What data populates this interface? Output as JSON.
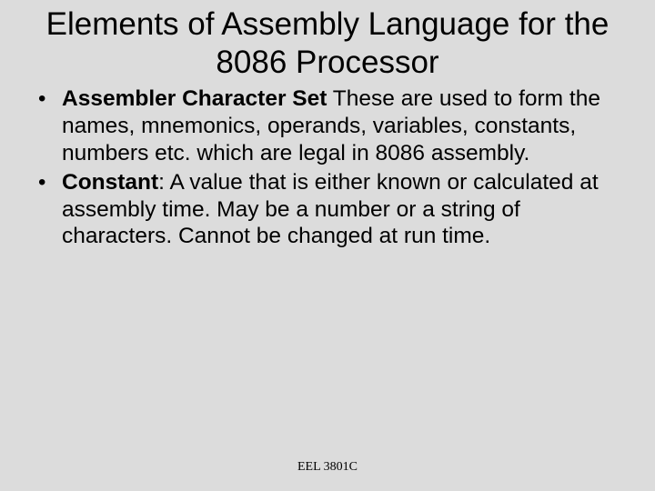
{
  "title": "Elements of Assembly Language for the 8086 Processor",
  "bullets": [
    {
      "term": "Assembler Character Set",
      "separator": " ",
      "definition": "These are used to form the names, mnemonics, operands, variables, constants, numbers etc. which are legal in 8086 assembly."
    },
    {
      "term": "Constant",
      "separator": ":  ",
      "definition": "A value that is either known or calculated at assembly time.  May be a number or a string of characters.  Cannot be changed at run time."
    }
  ],
  "footer": "EEL 3801C"
}
